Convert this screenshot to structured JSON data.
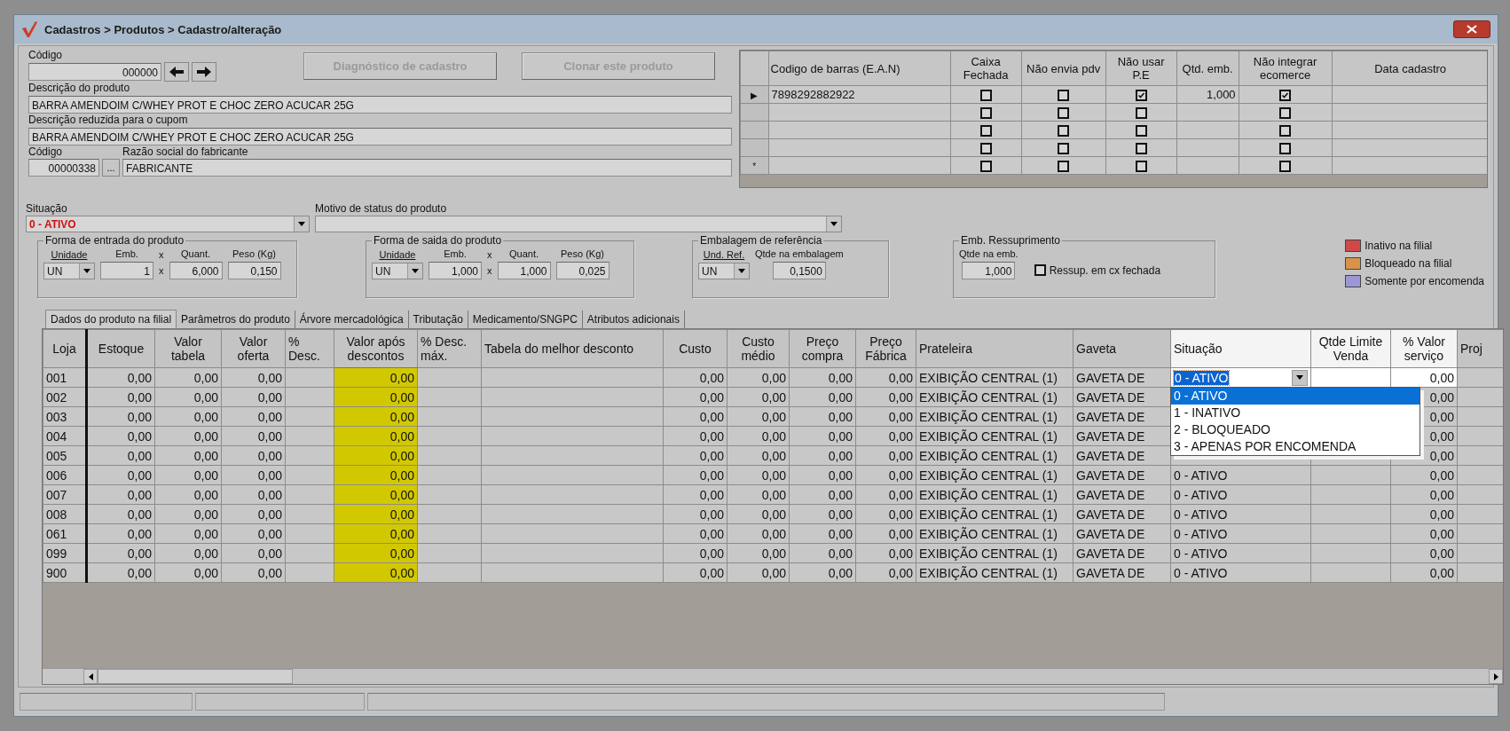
{
  "window": {
    "title": "Cadastros > Produtos > Cadastro/alteração"
  },
  "product": {
    "codigo": {
      "label": "Código",
      "value": "000000"
    },
    "buttons": [
      {
        "label": "Diagnóstico de cadastro",
        "disabled": true
      },
      {
        "label": "Clonar este produto",
        "disabled": true
      }
    ],
    "descricao": {
      "label": "Descrição  do produto",
      "value": "BARRA AMENDOIM C/WHEY PROT E CHOC ZERO ACUCAR 25G"
    },
    "descricao_reduzida": {
      "label": "Descrição reduzida para o cupom",
      "value": "BARRA AMENDOIM C/WHEY PROT E CHOC ZERO ACUCAR 25G"
    },
    "fabricante_codigo": {
      "label": "Código",
      "value": "00000338"
    },
    "fabricante_browse": "...",
    "fabricante_razao": {
      "label": "Razão social do fabricante",
      "value": "FABRICANTE"
    },
    "situacao": {
      "label": "Situação",
      "value": "0 - ATIVO"
    },
    "motivo": {
      "label": "Motivo de status do produto"
    }
  },
  "barcodes": {
    "columns": [
      {
        "label": "Codigo de barras (E.A.N)",
        "kind": "text"
      },
      {
        "label": "Caixa Fechada",
        "kind": "check"
      },
      {
        "label": "Não envia pdv",
        "kind": "check"
      },
      {
        "label": "Não usar P.E",
        "kind": "check"
      },
      {
        "label": "Qtd. emb.",
        "kind": "number"
      },
      {
        "label": "Não integrar ecomerce",
        "kind": "check"
      },
      {
        "label": "Data cadastro",
        "kind": "text"
      }
    ],
    "rows": [
      {
        "marker": "▶",
        "cells": [
          "7898292882922",
          false,
          false,
          true,
          "1,000",
          true,
          null
        ]
      },
      {
        "cells": [
          null,
          false,
          false,
          false,
          null,
          false,
          null
        ]
      },
      {
        "cells": [
          null,
          false,
          false,
          false,
          null,
          false,
          null
        ]
      },
      {
        "cells": [
          null,
          false,
          false,
          false,
          null,
          false,
          null
        ]
      },
      {
        "marker": "*",
        "cells": [
          null,
          false,
          false,
          false,
          null,
          false,
          null
        ]
      }
    ]
  },
  "groups": [
    {
      "title": "Forma de entrada do produto",
      "fields": [
        {
          "kind": "combo",
          "label": "Unidade",
          "value": "UN"
        },
        {
          "kind": "input",
          "label": "Emb.",
          "value": "1"
        },
        {
          "kind": "sep",
          "label": "x",
          "value": "x"
        },
        {
          "kind": "input",
          "label": "Quant.",
          "value": "6,000"
        },
        {
          "kind": "input",
          "label": "Peso (Kg)",
          "value": "0,150"
        }
      ]
    },
    {
      "title": "Forma de saida do produto",
      "fields": [
        {
          "kind": "combo",
          "label": "Unidade",
          "value": "UN"
        },
        {
          "kind": "input",
          "label": "Emb.",
          "value": "1,000"
        },
        {
          "kind": "sep",
          "label": "x",
          "value": "x"
        },
        {
          "kind": "input",
          "label": "Quant.",
          "value": "1,000"
        },
        {
          "kind": "input",
          "label": "Peso (Kg)",
          "value": "0,025"
        }
      ]
    },
    {
      "title": "Embalagem de referência",
      "fields": [
        {
          "kind": "combo",
          "label": "Und. Ref.",
          "value": "UN"
        },
        {
          "kind": "input",
          "label": "Qtde na embalagem",
          "value": "0,1500"
        }
      ]
    },
    {
      "title": "Emb. Ressuprimento",
      "fields": [
        {
          "kind": "input",
          "label": "Qtde na emb.",
          "value": "1,000"
        },
        {
          "kind": "checkbox",
          "label": "Ressup. em cx fechada",
          "checked": false
        }
      ]
    }
  ],
  "legend": [
    {
      "label": "Inativo na filial",
      "color": "#d04848"
    },
    {
      "label": "Bloqueado na filial",
      "color": "#d8924a"
    },
    {
      "label": "Somente por encomenda",
      "color": "#9c98d8"
    }
  ],
  "tabs": [
    {
      "label": "Dados do produto na filial",
      "selected": true
    },
    {
      "label": "Parâmetros do produto",
      "selected": false
    },
    {
      "label": "Árvore mercadológica",
      "selected": false
    },
    {
      "label": "Tributação",
      "selected": false
    },
    {
      "label": "Medicamento/SNGPC",
      "selected": false
    },
    {
      "label": "Atributos adicionais",
      "selected": false
    }
  ],
  "table": {
    "columns": [
      {
        "label": "Loja",
        "kind": "text",
        "highlight": false
      },
      {
        "label": "Estoque",
        "kind": "number",
        "highlight": false
      },
      {
        "label": "Valor tabela",
        "kind": "number",
        "highlight": false
      },
      {
        "label": "Valor oferta",
        "kind": "number",
        "highlight": false
      },
      {
        "label": "% Desc.",
        "kind": "number",
        "highlight": false
      },
      {
        "label": "Valor após descontos",
        "kind": "number",
        "highlight": true
      },
      {
        "label": "% Desc. máx.",
        "kind": "number",
        "highlight": false
      },
      {
        "label": "Tabela do melhor desconto",
        "kind": "text",
        "highlight": false
      },
      {
        "label": "Custo",
        "kind": "number",
        "highlight": false
      },
      {
        "label": "Custo médio",
        "kind": "number",
        "highlight": false
      },
      {
        "label": "Preço compra",
        "kind": "number",
        "highlight": false
      },
      {
        "label": "Preço Fábrica",
        "kind": "number",
        "highlight": false
      },
      {
        "label": "Prateleira",
        "kind": "text",
        "highlight": false
      },
      {
        "label": "Gaveta",
        "kind": "text",
        "highlight": false
      },
      {
        "label": "Situação",
        "kind": "status",
        "highlight": false
      },
      {
        "label": "Qtde Limite Venda",
        "kind": "number",
        "highlight": false
      },
      {
        "label": "% Valor serviço",
        "kind": "number",
        "highlight": false
      },
      {
        "label": "Proj",
        "kind": "text",
        "highlight": false
      }
    ],
    "rows": [
      {
        "editing": true,
        "cells": [
          "001",
          "0,00",
          "0,00",
          "0,00",
          null,
          "0,00",
          null,
          null,
          "0,00",
          "0,00",
          "0,00",
          "0,00",
          "EXIBIÇÃO CENTRAL (1)",
          "GAVETA DE",
          "0 - ATIVO",
          null,
          "0,00",
          null
        ]
      },
      {
        "editing": false,
        "cells": [
          "002",
          "0,00",
          "0,00",
          "0,00",
          null,
          "0,00",
          null,
          null,
          "0,00",
          "0,00",
          "0,00",
          "0,00",
          "EXIBIÇÃO CENTRAL (1)",
          "GAVETA DE",
          null,
          null,
          "0,00",
          null
        ]
      },
      {
        "editing": false,
        "cells": [
          "003",
          "0,00",
          "0,00",
          "0,00",
          null,
          "0,00",
          null,
          null,
          "0,00",
          "0,00",
          "0,00",
          "0,00",
          "EXIBIÇÃO CENTRAL (1)",
          "GAVETA DE",
          null,
          null,
          "0,00",
          null
        ]
      },
      {
        "editing": false,
        "cells": [
          "004",
          "0,00",
          "0,00",
          "0,00",
          null,
          "0,00",
          null,
          null,
          "0,00",
          "0,00",
          "0,00",
          "0,00",
          "EXIBIÇÃO CENTRAL (1)",
          "GAVETA DE",
          null,
          null,
          "0,00",
          null
        ]
      },
      {
        "editing": false,
        "cells": [
          "005",
          "0,00",
          "0,00",
          "0,00",
          null,
          "0,00",
          null,
          null,
          "0,00",
          "0,00",
          "0,00",
          "0,00",
          "EXIBIÇÃO CENTRAL (1)",
          "GAVETA DE",
          null,
          null,
          "0,00",
          null
        ]
      },
      {
        "editing": false,
        "cells": [
          "006",
          "0,00",
          "0,00",
          "0,00",
          null,
          "0,00",
          null,
          null,
          "0,00",
          "0,00",
          "0,00",
          "0,00",
          "EXIBIÇÃO CENTRAL (1)",
          "GAVETA DE",
          "0 - ATIVO",
          null,
          "0,00",
          null
        ]
      },
      {
        "editing": false,
        "cells": [
          "007",
          "0,00",
          "0,00",
          "0,00",
          null,
          "0,00",
          null,
          null,
          "0,00",
          "0,00",
          "0,00",
          "0,00",
          "EXIBIÇÃO CENTRAL (1)",
          "GAVETA DE",
          "0 - ATIVO",
          null,
          "0,00",
          null
        ]
      },
      {
        "editing": false,
        "cells": [
          "008",
          "0,00",
          "0,00",
          "0,00",
          null,
          "0,00",
          null,
          null,
          "0,00",
          "0,00",
          "0,00",
          "0,00",
          "EXIBIÇÃO CENTRAL (1)",
          "GAVETA DE",
          "0 - ATIVO",
          null,
          "0,00",
          null
        ]
      },
      {
        "editing": false,
        "cells": [
          "061",
          "0,00",
          "0,00",
          "0,00",
          null,
          "0,00",
          null,
          null,
          "0,00",
          "0,00",
          "0,00",
          "0,00",
          "EXIBIÇÃO CENTRAL (1)",
          "GAVETA DE",
          "0 - ATIVO",
          null,
          "0,00",
          null
        ]
      },
      {
        "editing": false,
        "cells": [
          "099",
          "0,00",
          "0,00",
          "0,00",
          null,
          "0,00",
          null,
          null,
          "0,00",
          "0,00",
          "0,00",
          "0,00",
          "EXIBIÇÃO CENTRAL (1)",
          "GAVETA DE",
          "0 - ATIVO",
          null,
          "0,00",
          null
        ]
      },
      {
        "editing": false,
        "cells": [
          "900",
          "0,00",
          "0,00",
          "0,00",
          null,
          "0,00",
          null,
          null,
          "0,00",
          "0,00",
          "0,00",
          "0,00",
          "EXIBIÇÃO CENTRAL (1)",
          "GAVETA DE",
          "0 - ATIVO",
          null,
          "0,00",
          null
        ]
      }
    ],
    "status_options": [
      {
        "label": "0 - ATIVO",
        "selected": true
      },
      {
        "label": "1 - INATIVO",
        "selected": false
      },
      {
        "label": "2 - BLOQUEADO",
        "selected": false
      },
      {
        "label": "3 - APENAS POR ENCOMENDA",
        "selected": false
      }
    ]
  }
}
